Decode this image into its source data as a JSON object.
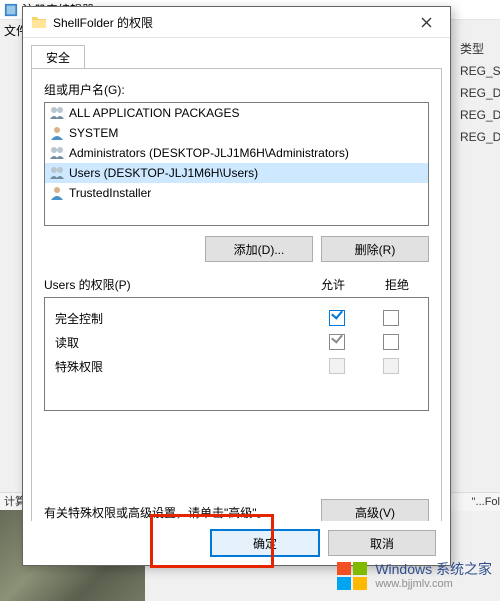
{
  "background": {
    "app_title": "注册表编辑器",
    "file_menu": "文件(",
    "type_header": "类型",
    "types": [
      "REG_S",
      "REG_D",
      "REG_D",
      "REG_D"
    ],
    "status_left": "计算机",
    "status_right": "\"...Fol"
  },
  "dialog": {
    "title": "ShellFolder 的权限",
    "tab_label": "安全",
    "group_label": "组或用户名(G):",
    "principals": [
      {
        "name": "ALL APPLICATION PACKAGES",
        "icon": "people"
      },
      {
        "name": "SYSTEM",
        "icon": "single"
      },
      {
        "name": "Administrators (DESKTOP-JLJ1M6H\\Administrators)",
        "icon": "people"
      },
      {
        "name": "Users (DESKTOP-JLJ1M6H\\Users)",
        "icon": "people",
        "selected": true
      },
      {
        "name": "TrustedInstaller",
        "icon": "single"
      }
    ],
    "buttons": {
      "add": "添加(D)...",
      "remove": "删除(R)"
    },
    "perm_header": {
      "title": "Users 的权限(P)",
      "allow": "允许",
      "deny": "拒绝"
    },
    "permissions": [
      {
        "label": "完全控制",
        "allow": "checked",
        "deny": "unchecked"
      },
      {
        "label": "读取",
        "allow": "checked-gray",
        "deny": "unchecked"
      },
      {
        "label": "特殊权限",
        "allow": "disabled",
        "deny": "disabled"
      }
    ],
    "advanced_text": "有关特殊权限或高级设置，请单击\"高级\"。",
    "advanced_btn": "高级(V)",
    "footer": {
      "ok": "确定",
      "cancel": "取消"
    }
  },
  "watermark": {
    "line1": "Windows 系统之家",
    "line2": "www.bjjmlv.com"
  }
}
